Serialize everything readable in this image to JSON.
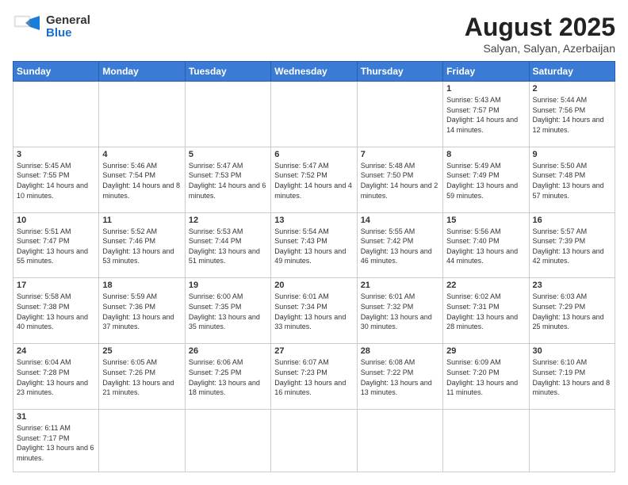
{
  "logo": {
    "text_general": "General",
    "text_blue": "Blue"
  },
  "header": {
    "month": "August 2025",
    "location": "Salyan, Salyan, Azerbaijan"
  },
  "days_of_week": [
    "Sunday",
    "Monday",
    "Tuesday",
    "Wednesday",
    "Thursday",
    "Friday",
    "Saturday"
  ],
  "weeks": [
    [
      {
        "day": "",
        "info": ""
      },
      {
        "day": "",
        "info": ""
      },
      {
        "day": "",
        "info": ""
      },
      {
        "day": "",
        "info": ""
      },
      {
        "day": "",
        "info": ""
      },
      {
        "day": "1",
        "info": "Sunrise: 5:43 AM\nSunset: 7:57 PM\nDaylight: 14 hours and 14 minutes."
      },
      {
        "day": "2",
        "info": "Sunrise: 5:44 AM\nSunset: 7:56 PM\nDaylight: 14 hours and 12 minutes."
      }
    ],
    [
      {
        "day": "3",
        "info": "Sunrise: 5:45 AM\nSunset: 7:55 PM\nDaylight: 14 hours and 10 minutes."
      },
      {
        "day": "4",
        "info": "Sunrise: 5:46 AM\nSunset: 7:54 PM\nDaylight: 14 hours and 8 minutes."
      },
      {
        "day": "5",
        "info": "Sunrise: 5:47 AM\nSunset: 7:53 PM\nDaylight: 14 hours and 6 minutes."
      },
      {
        "day": "6",
        "info": "Sunrise: 5:47 AM\nSunset: 7:52 PM\nDaylight: 14 hours and 4 minutes."
      },
      {
        "day": "7",
        "info": "Sunrise: 5:48 AM\nSunset: 7:50 PM\nDaylight: 14 hours and 2 minutes."
      },
      {
        "day": "8",
        "info": "Sunrise: 5:49 AM\nSunset: 7:49 PM\nDaylight: 13 hours and 59 minutes."
      },
      {
        "day": "9",
        "info": "Sunrise: 5:50 AM\nSunset: 7:48 PM\nDaylight: 13 hours and 57 minutes."
      }
    ],
    [
      {
        "day": "10",
        "info": "Sunrise: 5:51 AM\nSunset: 7:47 PM\nDaylight: 13 hours and 55 minutes."
      },
      {
        "day": "11",
        "info": "Sunrise: 5:52 AM\nSunset: 7:46 PM\nDaylight: 13 hours and 53 minutes."
      },
      {
        "day": "12",
        "info": "Sunrise: 5:53 AM\nSunset: 7:44 PM\nDaylight: 13 hours and 51 minutes."
      },
      {
        "day": "13",
        "info": "Sunrise: 5:54 AM\nSunset: 7:43 PM\nDaylight: 13 hours and 49 minutes."
      },
      {
        "day": "14",
        "info": "Sunrise: 5:55 AM\nSunset: 7:42 PM\nDaylight: 13 hours and 46 minutes."
      },
      {
        "day": "15",
        "info": "Sunrise: 5:56 AM\nSunset: 7:40 PM\nDaylight: 13 hours and 44 minutes."
      },
      {
        "day": "16",
        "info": "Sunrise: 5:57 AM\nSunset: 7:39 PM\nDaylight: 13 hours and 42 minutes."
      }
    ],
    [
      {
        "day": "17",
        "info": "Sunrise: 5:58 AM\nSunset: 7:38 PM\nDaylight: 13 hours and 40 minutes."
      },
      {
        "day": "18",
        "info": "Sunrise: 5:59 AM\nSunset: 7:36 PM\nDaylight: 13 hours and 37 minutes."
      },
      {
        "day": "19",
        "info": "Sunrise: 6:00 AM\nSunset: 7:35 PM\nDaylight: 13 hours and 35 minutes."
      },
      {
        "day": "20",
        "info": "Sunrise: 6:01 AM\nSunset: 7:34 PM\nDaylight: 13 hours and 33 minutes."
      },
      {
        "day": "21",
        "info": "Sunrise: 6:01 AM\nSunset: 7:32 PM\nDaylight: 13 hours and 30 minutes."
      },
      {
        "day": "22",
        "info": "Sunrise: 6:02 AM\nSunset: 7:31 PM\nDaylight: 13 hours and 28 minutes."
      },
      {
        "day": "23",
        "info": "Sunrise: 6:03 AM\nSunset: 7:29 PM\nDaylight: 13 hours and 25 minutes."
      }
    ],
    [
      {
        "day": "24",
        "info": "Sunrise: 6:04 AM\nSunset: 7:28 PM\nDaylight: 13 hours and 23 minutes."
      },
      {
        "day": "25",
        "info": "Sunrise: 6:05 AM\nSunset: 7:26 PM\nDaylight: 13 hours and 21 minutes."
      },
      {
        "day": "26",
        "info": "Sunrise: 6:06 AM\nSunset: 7:25 PM\nDaylight: 13 hours and 18 minutes."
      },
      {
        "day": "27",
        "info": "Sunrise: 6:07 AM\nSunset: 7:23 PM\nDaylight: 13 hours and 16 minutes."
      },
      {
        "day": "28",
        "info": "Sunrise: 6:08 AM\nSunset: 7:22 PM\nDaylight: 13 hours and 13 minutes."
      },
      {
        "day": "29",
        "info": "Sunrise: 6:09 AM\nSunset: 7:20 PM\nDaylight: 13 hours and 11 minutes."
      },
      {
        "day": "30",
        "info": "Sunrise: 6:10 AM\nSunset: 7:19 PM\nDaylight: 13 hours and 8 minutes."
      }
    ],
    [
      {
        "day": "31",
        "info": "Sunrise: 6:11 AM\nSunset: 7:17 PM\nDaylight: 13 hours and 6 minutes."
      },
      {
        "day": "",
        "info": ""
      },
      {
        "day": "",
        "info": ""
      },
      {
        "day": "",
        "info": ""
      },
      {
        "day": "",
        "info": ""
      },
      {
        "day": "",
        "info": ""
      },
      {
        "day": "",
        "info": ""
      }
    ]
  ]
}
